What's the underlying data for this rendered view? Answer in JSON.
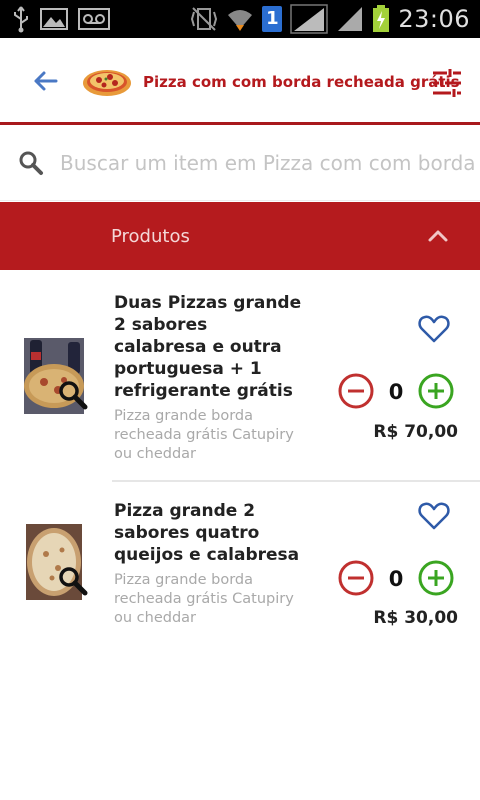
{
  "status_bar": {
    "time": "23:06",
    "sim_badge": "1",
    "icons": [
      "usb-icon",
      "gallery-icon",
      "voicemail-icon",
      "vibrate-icon",
      "wifi-icon",
      "signal-icon",
      "battery-charging-icon"
    ]
  },
  "header": {
    "title": "Pizza com com borda recheada grátis",
    "back_icon": "arrow-left-icon",
    "filter_icon": "tune-icon",
    "accent_color": "#b4191d"
  },
  "search": {
    "placeholder": "Buscar um item em Pizza com com borda recheada grátis"
  },
  "section": {
    "title": "Produtos",
    "background": "#b51b1e",
    "chevron_icon": "chevron-up-icon"
  },
  "products": [
    {
      "name": "Duas Pizzas grande 2 sabores calabresa e outra portuguesa + 1 refrigerante grátis",
      "description": "Pizza grande borda recheada grátis Catupiry ou cheddar",
      "quantity": "0",
      "price": "R$ 70,00"
    },
    {
      "name": "Pizza grande 2 sabores quatro queijos e calabresa",
      "description": "Pizza grande borda recheada grátis Catupiry ou cheddar",
      "quantity": "0",
      "price": "R$ 30,00"
    }
  ],
  "colors": {
    "minus": "#c0302f",
    "plus": "#3aa521",
    "favorite": "#2e5aa8"
  }
}
